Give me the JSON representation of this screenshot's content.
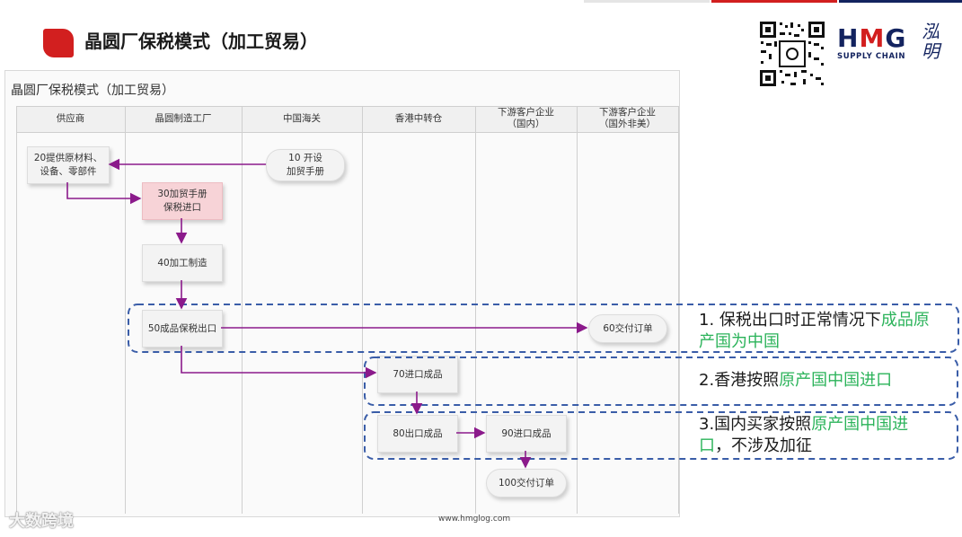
{
  "page": {
    "title": "晶圆厂保税模式（加工贸易）",
    "footer_url": "www.hmglog.com",
    "watermark": "大数跨境"
  },
  "logo": {
    "main_h": "H",
    "main_m": "M",
    "main_g": "G",
    "sub": "SUPPLY CHAIN",
    "cn": "泓明"
  },
  "diagram": {
    "title": "晶圆厂保税模式（加工贸易）",
    "lanes": [
      "供应商",
      "晶圆制造工厂",
      "中国海关",
      "香港中转仓",
      "下游客户企业\n（国内）",
      "下游客户企业\n（国外非美）"
    ],
    "steps": {
      "s20": "20提供原材料、\n设备、零部件",
      "s10": "10 开设\n加贸手册",
      "s30": "30加贸手册\n保税进口",
      "s40": "40加工制造",
      "s50": "50成品保税出口",
      "s60": "60交付订单",
      "s70": "70进口成品",
      "s80": "80出口成品",
      "s90": "90进口成品",
      "s100": "100交付订单"
    },
    "colors": {
      "arrow": "#8b1a8b",
      "dash": "#3a5da8",
      "highlight": "#2bb35a",
      "pink_box": "#f7d3d7"
    }
  },
  "notes": [
    {
      "plain": "1. 保税出口时正常情况下",
      "highlight": "成品原产国为中国",
      "tail": ""
    },
    {
      "plain": "2.香港按照",
      "highlight": "原产国中国进口",
      "tail": ""
    },
    {
      "plain": "3.国内买家按照",
      "highlight": "原产国中国进口",
      "tail": "，不涉及加征"
    }
  ]
}
